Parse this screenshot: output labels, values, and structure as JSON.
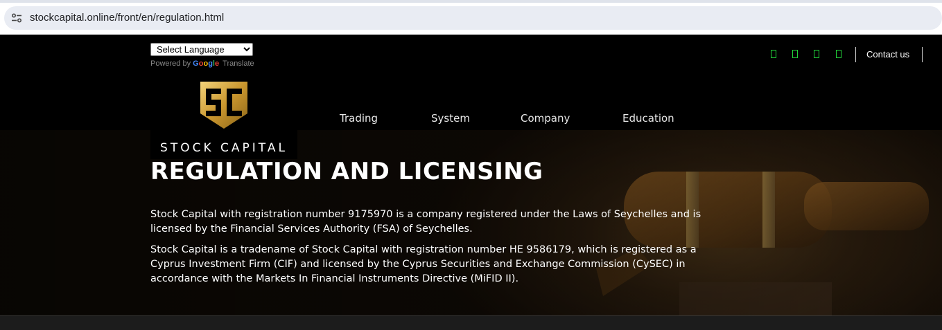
{
  "browser": {
    "url": "stockcapital.online/front/en/regulation.html",
    "site_info_icon": "tune-icon"
  },
  "translate": {
    "select_label": "Select Language",
    "powered_by": "Powered by",
    "google": "Google",
    "translate": "Translate"
  },
  "logo": {
    "emblem_icon": "sc-shield-logo",
    "text": "STOCK CAPITAL",
    "color": "#d4a63a"
  },
  "nav": {
    "items": [
      {
        "label": "Trading"
      },
      {
        "label": "System"
      },
      {
        "label": "Company"
      },
      {
        "label": "Education"
      }
    ]
  },
  "header": {
    "social_icons": [
      "social-icon-1",
      "social-icon-2",
      "social-icon-3",
      "social-icon-4"
    ],
    "social_color": "#22d33a",
    "contact_label": "Contact us"
  },
  "hero": {
    "title": "REGULATION AND LICENSING",
    "paragraph_1": "Stock Capital with registration number 9175970 is a company registered under the Laws of Seychelles and is licensed by the Financial Services Authority (FSA) of Seychelles.",
    "paragraph_2": "Stock Capital is a tradename of Stock Capital with registration number HE 9586179, which is registered as a Cyprus Investment Firm (CIF) and licensed by the Cyprus Securities and Exchange Commission (CySEC) in accordance with the Markets In Financial Instruments Directive (MiFID II)."
  }
}
